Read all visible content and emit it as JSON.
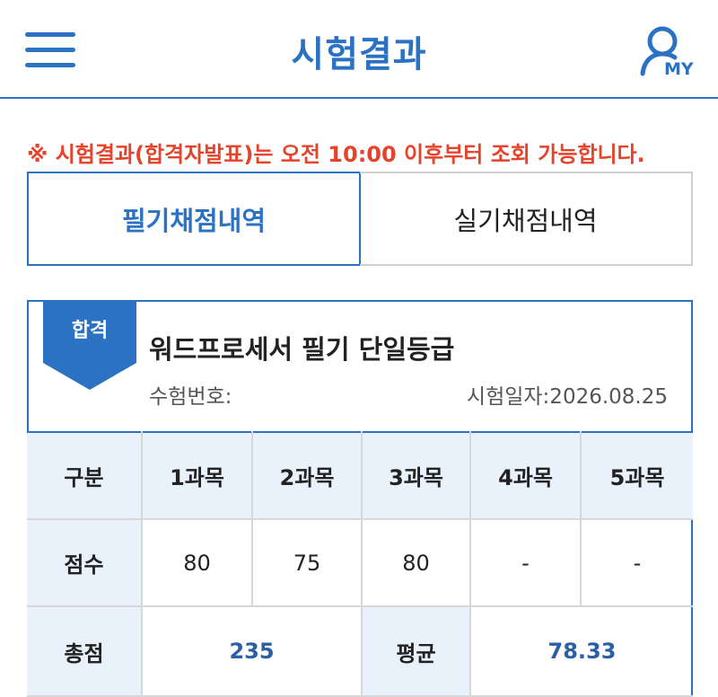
{
  "header": {
    "title": "시험결과",
    "menu_icon": "hamburger-menu-icon",
    "my_icon": "user-icon",
    "my_label": "MY"
  },
  "notice": "※ 시험결과(합격자발표)는 오전 10:00 이후부터 조회 가능합니다.",
  "tabs": [
    {
      "label": "필기채점내역",
      "active": true
    },
    {
      "label": "실기채점내역",
      "active": false
    }
  ],
  "result": {
    "badge": "합격",
    "exam_name": "워드프로세서 필기 단일등급",
    "exam_no_label": "수험번호:",
    "exam_no_value": "",
    "exam_date": "시험일자:2026.08.25",
    "table": {
      "header": [
        "구분",
        "1과목",
        "2과목",
        "3과목",
        "4과목",
        "5과목"
      ],
      "score_label": "점수",
      "scores": [
        "80",
        "75",
        "80",
        "-",
        "-"
      ],
      "total_label": "총점",
      "total_value": "235",
      "avg_label": "평균",
      "avg_value": "78.33"
    }
  },
  "colors": {
    "accent": "#2b73c2",
    "notice": "#e5432b",
    "table_header_bg": "#e9f1fb",
    "value_blue": "#2b5fa6"
  }
}
